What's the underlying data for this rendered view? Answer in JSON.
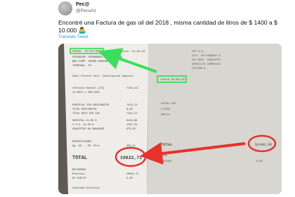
{
  "tweet": {
    "display_name": "Pec@",
    "handle": "@PecoAz",
    "text": "Encontré una Factura de gas oil del 2018 , misma cantidad de litros de $ 1400 a $ 10.000 🤷‍♂️",
    "translate_label": "Translate Tweet"
  },
  "receipt_left": {
    "date_line": "FECHA: 07/07/2022",
    "time": "Hora: 11:32:29",
    "header_lines": [
      "OPERADOR: FERNANDEZ, DAMIAN GAB",
      "NRO.COMP: 00900-00008090",
      "TERMINAL: 07"
    ],
    "item_header": "Cant./Precio Unit.  Descripcion  Importe",
    "product": "Infinia Diesel (IX)",
    "product_qty": "14,8014 x 290,2501",
    "product_amount": "7422,21",
    "subtotal_label": "SUBTOTAL SIN DESCUENTOS",
    "subtotal_amount": "7422,21",
    "lines": [
      "TOTAL DESCUENTOS",
      "TOTAL NETO SIN IVA",
      "SUBTOTAL 21,00 %",
      "I.V.A. 21,00 %",
      "CONCEPTOS NO GRAVADOS"
    ],
    "lines_amounts": [
      "0,00",
      "7422,21",
      "6129,98",
      "1287,29",
      "975,92"
    ],
    "percepciones": "PERCEPCIONES",
    "iibb": "Ag. Ab. - IB. Perc.",
    "iibb_amount": "402,11",
    "total_label": "TOTAL",
    "total_amount": "10822,71",
    "payment_lines": [
      "RECIBIMOS",
      "Efectivo",
      "SU VUELTO"
    ],
    "payment_amounts": [
      "10822,71",
      "0,00"
    ],
    "footer": "Cantidad Articulos"
  },
  "receipt_right": {
    "header_lines": [
      "YPF S.A.",
      "CUIT: 30-54668997-9",
      "IVA RESP. INSCRIPTO",
      "DOMICILIO COMERCIAL",
      "FACTURA B"
    ],
    "date_line": "Fecha 25/09/18",
    "product_lines": [
      "DIESEL 500",
      "LITROS",
      "PRECIO"
    ],
    "total_label": "TOTAL",
    "total_amount": "$1400,00",
    "payment_lines": [
      "PAGO",
      "CONTADO"
    ],
    "payment_amount": "0,00"
  },
  "annotations": {
    "highlight_color": "#3be05a",
    "circle_color": "#e8312a"
  }
}
